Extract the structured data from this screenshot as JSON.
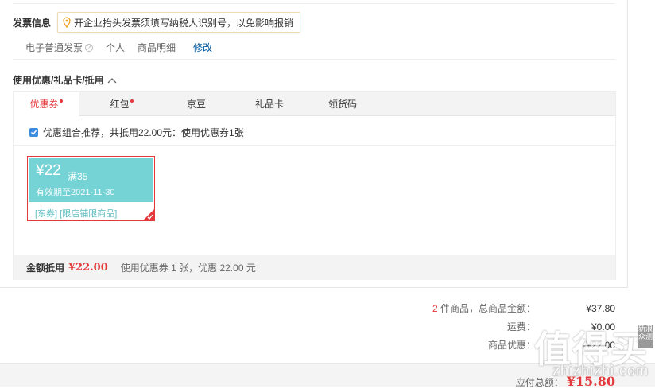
{
  "invoice": {
    "title": "发票信息",
    "tip": "开企业抬头发票须填写纳税人识别号，以免影响报销",
    "type": "电子普通发票",
    "holder": "个人",
    "content": "商品明细",
    "edit": "修改"
  },
  "coupons": {
    "title": "使用优惠/礼品卡/抵用",
    "tabs": [
      {
        "label": "优惠券",
        "dot": true
      },
      {
        "label": "红包",
        "dot": true
      },
      {
        "label": "京豆",
        "dot": false
      },
      {
        "label": "礼品卡",
        "dot": false
      },
      {
        "label": "领货码",
        "dot": false
      }
    ],
    "combo_text": "优惠组合推荐，共抵用22.00元：使用优惠券1张",
    "card": {
      "amount": "¥22",
      "condition": "满35",
      "valid": "有效期至2021-11-30",
      "scope": "[东券] [限店铺限商品]"
    },
    "total_label": "金额抵用",
    "total_amount": "¥22.00",
    "total_desc": "使用优惠券 1 张，优惠 22.00 元"
  },
  "summary": {
    "count": "2",
    "count_label": "件商品，总商品金额：",
    "goods_total": "¥37.80",
    "shipping_label": "运费：",
    "shipping": "¥0.00",
    "discount_label": "商品优惠：",
    "discount": "-¥22.00"
  },
  "payment": {
    "label": "应付总额：",
    "amount": "¥15.80"
  },
  "watermark": {
    "text": "值得买",
    "url": "zhizhizhi.com",
    "badge": "新浪众测"
  },
  "colors": {
    "accent": "#e4393c",
    "coupon": "#76d3d5",
    "link": "#005aa0"
  }
}
